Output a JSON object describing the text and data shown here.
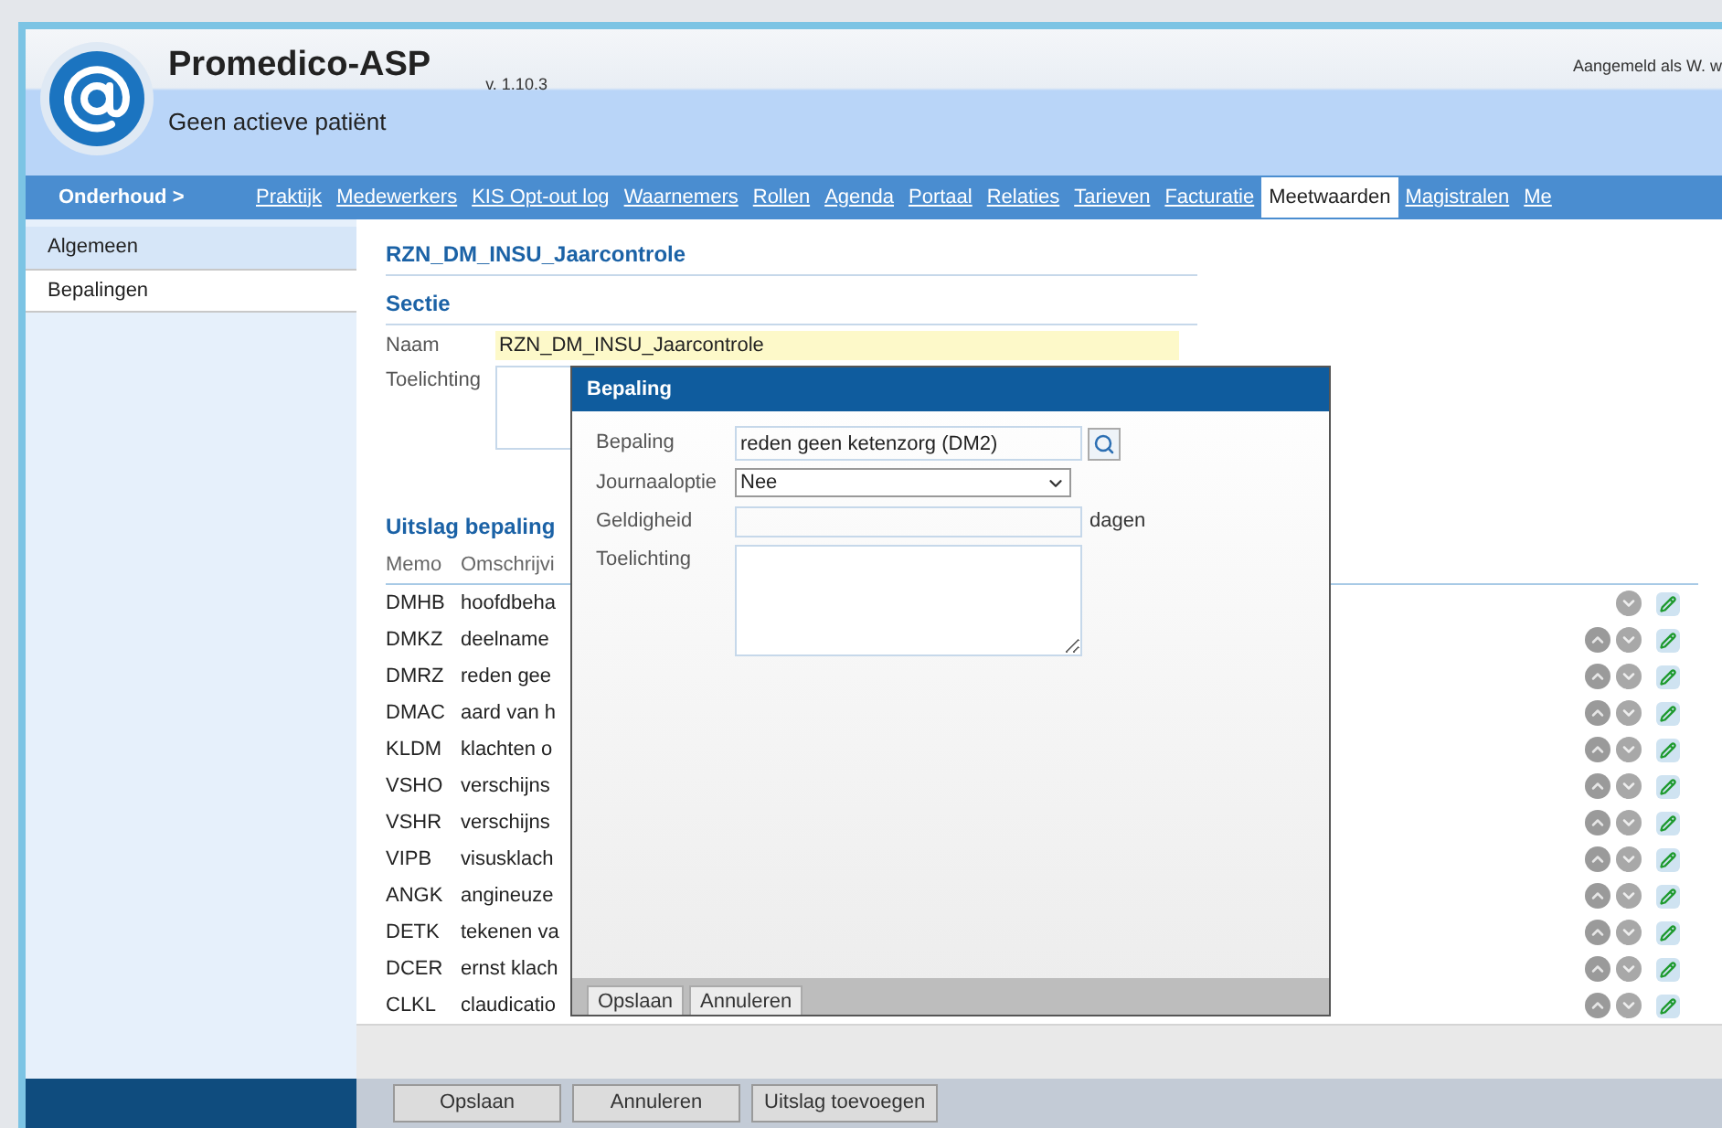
{
  "header": {
    "title": "Promedico-ASP",
    "version": "v. 1.10.3",
    "patient": "Geen actieve patiënt",
    "user": "Aangemeld als W. w"
  },
  "nav": {
    "section": "Onderhoud >",
    "items": [
      {
        "label": "Praktijk",
        "selected": false
      },
      {
        "label": "Medewerkers",
        "selected": false
      },
      {
        "label": "KIS Opt-out log",
        "selected": false
      },
      {
        "label": "Waarnemers",
        "selected": false
      },
      {
        "label": "Rollen",
        "selected": false
      },
      {
        "label": "Agenda",
        "selected": false
      },
      {
        "label": "Portaal",
        "selected": false
      },
      {
        "label": "Relaties",
        "selected": false
      },
      {
        "label": "Tarieven",
        "selected": false
      },
      {
        "label": "Facturatie",
        "selected": false
      },
      {
        "label": "Meetwaarden",
        "selected": true
      },
      {
        "label": "Magistralen",
        "selected": false
      },
      {
        "label": "Me",
        "selected": false
      }
    ]
  },
  "sidebar": {
    "items": [
      {
        "label": "Algemeen",
        "selected": false
      },
      {
        "label": "Bepalingen",
        "selected": true
      }
    ]
  },
  "form": {
    "title": "RZN_DM_INSU_Jaarcontrole",
    "section": "Sectie",
    "name_label": "Naam",
    "name_value": "RZN_DM_INSU_Jaarcontrole",
    "note_label": "Toelichting"
  },
  "results": {
    "title": "Uitslag bepaling",
    "columns": [
      "Memo",
      "Omschrijvi"
    ],
    "rows": [
      {
        "memo": "DMHB",
        "description": "hoofdbeha",
        "can_move_up": false
      },
      {
        "memo": "DMKZ",
        "description": "deelname",
        "can_move_up": true
      },
      {
        "memo": "DMRZ",
        "description": "reden gee",
        "can_move_up": true
      },
      {
        "memo": "DMAC",
        "description": "aard van h",
        "can_move_up": true
      },
      {
        "memo": "KLDM",
        "description": "klachten o",
        "can_move_up": true
      },
      {
        "memo": "VSHO",
        "description": "verschijns",
        "can_move_up": true
      },
      {
        "memo": "VSHR",
        "description": "verschijns",
        "can_move_up": true
      },
      {
        "memo": "VIPB",
        "description": "visusklach",
        "can_move_up": true
      },
      {
        "memo": "ANGK",
        "description": "angineuze",
        "can_move_up": true
      },
      {
        "memo": "DETK",
        "description": "tekenen va",
        "can_move_up": true
      },
      {
        "memo": "DCER",
        "description": "ernst klach",
        "can_move_up": true
      },
      {
        "memo": "CLKL",
        "description": "claudicatio",
        "can_move_up": true
      }
    ]
  },
  "dialog": {
    "title": "Bepaling",
    "bepaling_label": "Bepaling",
    "bepaling_value": "reden geen ketenzorg (DM2)",
    "journaal_label": "Journaaloptie",
    "journaal_value": "Nee",
    "geldigheid_label": "Geldigheid",
    "geldigheid_unit": "dagen",
    "note_label": "Toelichting",
    "buttons": [
      "Opslaan",
      "Annuleren"
    ]
  },
  "buttons": [
    "Opslaan",
    "Annuleren",
    "Uitslag toevoegen"
  ]
}
